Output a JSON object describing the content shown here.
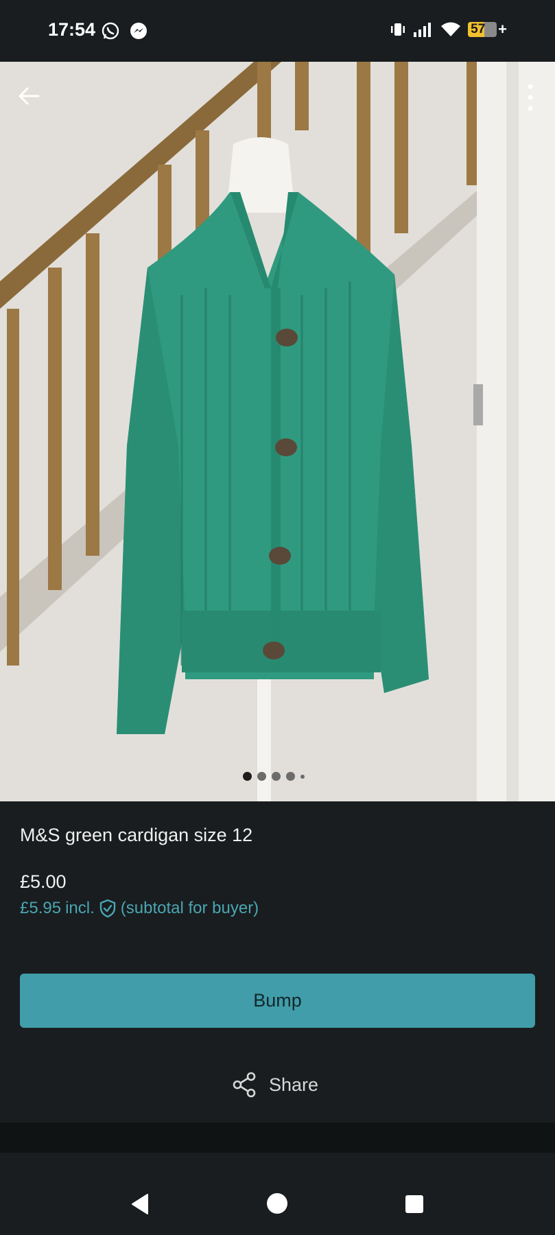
{
  "status_bar": {
    "time": "17:54",
    "battery_level": "57",
    "battery_percent": 57,
    "icons": [
      "whatsapp-icon",
      "messenger-icon",
      "vibrate-icon",
      "signal-icon",
      "wifi-icon",
      "battery-icon"
    ]
  },
  "gallery": {
    "image_count": 5,
    "active_index": 0,
    "image_description_icon": "cardigan-photo"
  },
  "listing": {
    "title": "M&S green cardigan size 12",
    "price": "£5.00",
    "price_incl": "£5.95",
    "incl_label": "incl.",
    "subtotal_note": "(subtotal for buyer)"
  },
  "actions": {
    "bump_label": "Bump",
    "share_label": "Share"
  },
  "colors": {
    "background": "#191d1f",
    "accent": "#409da9",
    "accent_text": "#4aa6b2",
    "cardigan": "#2f9a7f"
  }
}
